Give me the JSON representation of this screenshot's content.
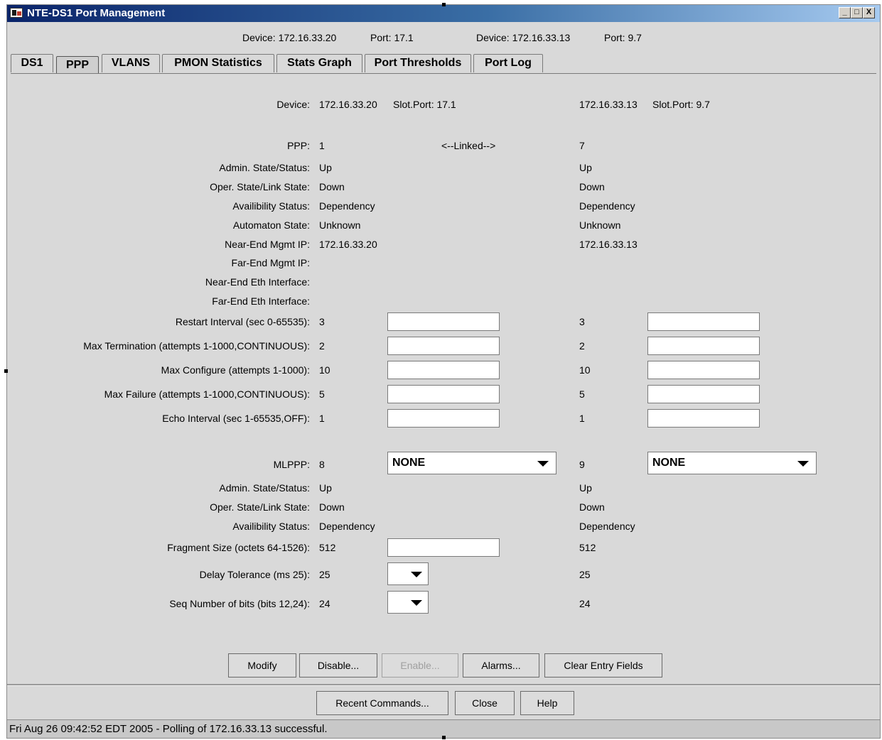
{
  "window": {
    "title": "NTE-DS1 Port Management",
    "minimize": "_",
    "maximize": "□",
    "close": "X"
  },
  "header": {
    "device_a": "Device:  172.16.33.20",
    "port_a": "Port:  17.1",
    "device_b": "Device:  172.16.33.13",
    "port_b": "Port:  9.7"
  },
  "tabs": [
    {
      "label": "DS1"
    },
    {
      "label": "PPP"
    },
    {
      "label": "VLANS"
    },
    {
      "label": "PMON Statistics"
    },
    {
      "label": "Stats Graph"
    },
    {
      "label": "Port Thresholds"
    },
    {
      "label": "Port Log"
    }
  ],
  "selected_tab": "PPP",
  "ppp": {
    "device_label": "Device:",
    "near_device": "172.16.33.20",
    "near_slotport": "Slot.Port: 17.1",
    "far_device": "172.16.33.13",
    "far_slotport": "Slot.Port: 9.7",
    "linked": "<--Linked-->",
    "rows": [
      {
        "label": "PPP:",
        "near": "1",
        "far": "7"
      },
      {
        "label": "Admin. State/Status:",
        "near": "Up",
        "far": "Up"
      },
      {
        "label": "Oper. State/Link State:",
        "near": "Down",
        "far": "Down"
      },
      {
        "label": "Availibility Status:",
        "near": "Dependency",
        "far": "Dependency"
      },
      {
        "label": "Automaton State:",
        "near": "Unknown",
        "far": "Unknown"
      },
      {
        "label": "Near-End Mgmt IP:",
        "near": "172.16.33.20",
        "far": "172.16.33.13"
      },
      {
        "label": "Far-End Mgmt IP:",
        "near": "",
        "far": ""
      },
      {
        "label": "Near-End Eth Interface:",
        "near": "",
        "far": ""
      },
      {
        "label": "Far-End Eth Interface:",
        "near": "",
        "far": ""
      }
    ],
    "editable_rows": [
      {
        "label": "Restart Interval (sec 0-65535):",
        "near": "3",
        "far": "3",
        "near_input": "",
        "far_input": ""
      },
      {
        "label": "Max Termination (attempts 1-1000,CONTINUOUS):",
        "near": "2",
        "far": "2",
        "near_input": "",
        "far_input": ""
      },
      {
        "label": "Max Configure (attempts 1-1000):",
        "near": "10",
        "far": "10",
        "near_input": "",
        "far_input": ""
      },
      {
        "label": "Max Failure (attempts 1-1000,CONTINUOUS):",
        "near": "5",
        "far": "5",
        "near_input": "",
        "far_input": ""
      },
      {
        "label": "Echo Interval (sec 1-65535,OFF):",
        "near": "1",
        "far": "1",
        "near_input": "",
        "far_input": ""
      }
    ]
  },
  "mlppp": {
    "label": "MLPPP:",
    "near": "8",
    "far": "9",
    "near_select": "NONE",
    "far_select": "NONE",
    "rows": [
      {
        "label": "Admin. State/Status:",
        "near": "Up",
        "far": "Up"
      },
      {
        "label": "Oper. State/Link State:",
        "near": "Down",
        "far": "Down"
      },
      {
        "label": "Availibility Status:",
        "near": "Dependency",
        "far": "Dependency"
      }
    ],
    "fragment": {
      "label": "Fragment Size (octets 64-1526):",
      "near": "512",
      "far": "512",
      "input": ""
    },
    "delay": {
      "label": "Delay Tolerance (ms 25):",
      "near": "25",
      "far": "25",
      "select": ""
    },
    "seq": {
      "label": "Seq Number of bits (bits 12,24):",
      "near": "24",
      "far": "24",
      "select": ""
    }
  },
  "actions": {
    "modify": "Modify",
    "disable": "Disable...",
    "enable": "Enable...",
    "alarms": "Alarms...",
    "clear": "Clear Entry Fields"
  },
  "footer": {
    "recent": "Recent Commands...",
    "close": "Close",
    "help": "Help"
  },
  "status": "Fri Aug 26 09:42:52 EDT 2005 - Polling of 172.16.33.13 successful."
}
